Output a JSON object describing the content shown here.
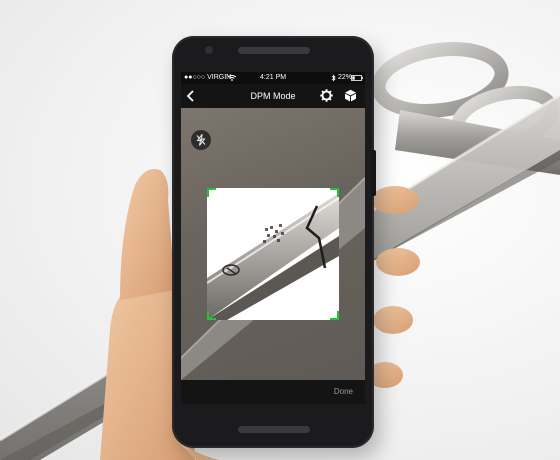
{
  "status_bar": {
    "carrier": "●●○○○ VIRGIN",
    "time": "4:21 PM",
    "battery": "22%"
  },
  "nav_bar": {
    "title": "DPM Mode",
    "back_icon": "chevron-left-icon",
    "settings_icon": "gear-icon",
    "mode_icon": "cube-icon"
  },
  "viewfinder": {
    "flash_icon": "flash-off-icon"
  },
  "bottom_bar": {
    "done_label": "Done"
  },
  "colors": {
    "bar_background": "#141414",
    "scan_corner": "#22c43a",
    "done_text": "#9a9a9a"
  }
}
